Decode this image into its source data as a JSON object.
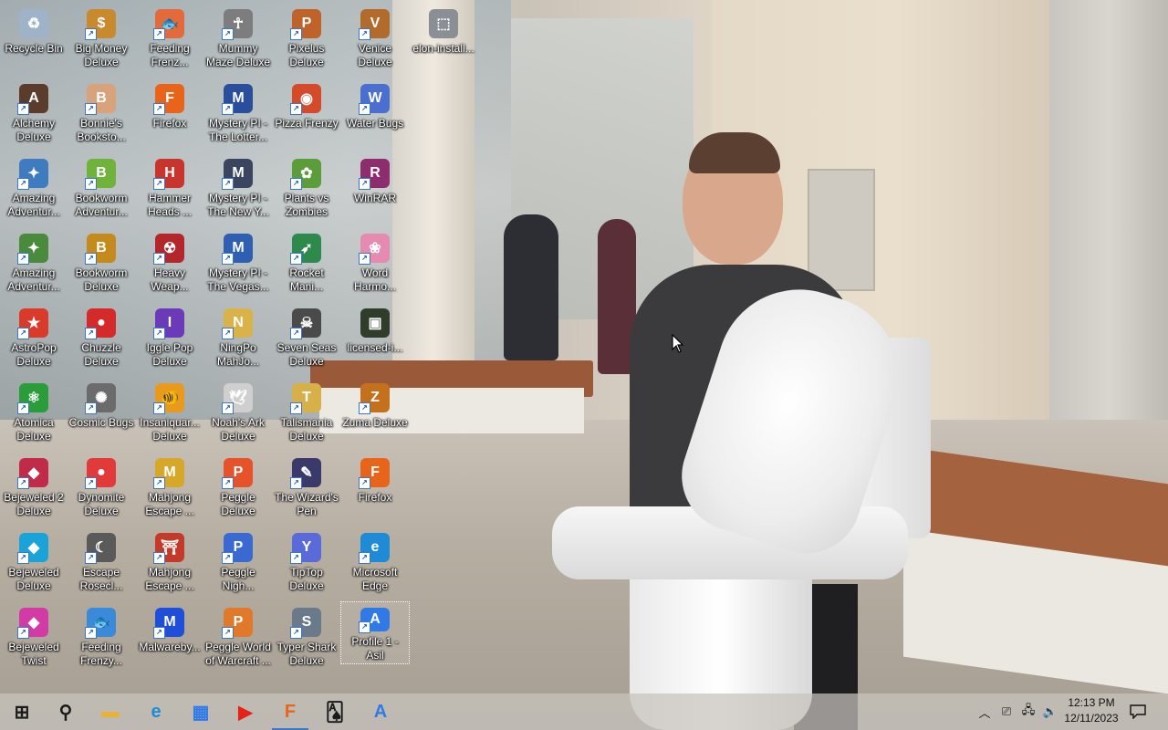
{
  "desktop": {
    "icons": [
      {
        "label": "Recycle Bin",
        "icon": "recycle-bin-icon",
        "color": "#9fb3c8",
        "glyph": "♻"
      },
      {
        "label": "Big Money\nDeluxe",
        "icon": "big-money-icon",
        "color": "#c98a2e",
        "glyph": "$"
      },
      {
        "label": "Feeding\nFrenz...",
        "icon": "feeding-frenzy-icon",
        "color": "#e36a3a",
        "glyph": "🐟"
      },
      {
        "label": "Mummy\nMaze Deluxe",
        "icon": "mummy-maze-icon",
        "color": "#7d7d7d",
        "glyph": "☥"
      },
      {
        "label": "Pixelus\nDeluxe",
        "icon": "pixelus-icon",
        "color": "#c0632b",
        "glyph": "P"
      },
      {
        "label": "Venice\nDeluxe",
        "icon": "venice-icon",
        "color": "#b36b2b",
        "glyph": "V"
      },
      {
        "label": "elon-install...",
        "icon": "installer-file-icon",
        "color": "#8a8f95",
        "glyph": "⬚"
      },
      {
        "label": "Alchemy\nDeluxe",
        "icon": "alchemy-icon",
        "color": "#5b3b2b",
        "glyph": "A"
      },
      {
        "label": "Bonnie's\nBooksto...",
        "icon": "bonnies-bookstore-icon",
        "color": "#d8a27a",
        "glyph": "B"
      },
      {
        "label": "Firefox",
        "icon": "firefox-icon",
        "color": "#e8641b",
        "glyph": "F"
      },
      {
        "label": "Mystery PI -\nThe Lotter...",
        "icon": "mystery-pi-lottery-icon",
        "color": "#2a4e9c",
        "glyph": "M"
      },
      {
        "label": "Pizza Frenzy",
        "icon": "pizza-frenzy-icon",
        "color": "#d34b2a",
        "glyph": "◉"
      },
      {
        "label": "Water Bugs",
        "icon": "water-bugs-icon",
        "color": "#4a6fd1",
        "glyph": "W"
      },
      {
        "label": "Amazing\nAdventur...",
        "icon": "amazing-adventures-icon",
        "color": "#3e7bbf",
        "glyph": "✦"
      },
      {
        "label": "Bookworm\nAdventur...",
        "icon": "bookworm-adventures-icon",
        "color": "#6fb23c",
        "glyph": "B"
      },
      {
        "label": "Hammer\nHeads ...",
        "icon": "hammer-heads-icon",
        "color": "#c7352d",
        "glyph": "H"
      },
      {
        "label": "Mystery PI -\nThe New Y...",
        "icon": "mystery-pi-new-york-icon",
        "color": "#3a4660",
        "glyph": "M"
      },
      {
        "label": "Plants vs\nZombies",
        "icon": "plants-vs-zombies-icon",
        "color": "#5b9d3a",
        "glyph": "✿"
      },
      {
        "label": "WinRAR",
        "icon": "winrar-icon",
        "color": "#8d2d6e",
        "glyph": "R"
      },
      {
        "label": "Amazing\nAdventur...",
        "icon": "amazing-adventures-2-icon",
        "color": "#4a8a3c",
        "glyph": "✦"
      },
      {
        "label": "Bookworm\nDeluxe",
        "icon": "bookworm-deluxe-icon",
        "color": "#c48a1c",
        "glyph": "B"
      },
      {
        "label": "Heavy\nWeap...",
        "icon": "heavy-weapon-icon",
        "color": "#b3262a",
        "glyph": "☢"
      },
      {
        "label": "Mystery PI -\nThe Vegas...",
        "icon": "mystery-pi-vegas-icon",
        "color": "#2f5fb0",
        "glyph": "M"
      },
      {
        "label": "Rocket\nMani...",
        "icon": "rocket-mania-icon",
        "color": "#2e8a4c",
        "glyph": "➶"
      },
      {
        "label": "Word\nHarmo...",
        "icon": "word-harmony-icon",
        "color": "#e58ab0",
        "glyph": "❀"
      },
      {
        "label": "AstroPop\nDeluxe",
        "icon": "astropop-icon",
        "color": "#d93a2a",
        "glyph": "★"
      },
      {
        "label": "Chuzzle\nDeluxe",
        "icon": "chuzzle-icon",
        "color": "#d42a2a",
        "glyph": "●"
      },
      {
        "label": "Iggle Pop\nDeluxe",
        "icon": "iggle-pop-icon",
        "color": "#6a3ab8",
        "glyph": "I"
      },
      {
        "label": "NingPo\nMahJo...",
        "icon": "ningpo-mahjong-icon",
        "color": "#d9b24a",
        "glyph": "N"
      },
      {
        "label": "Seven Seas\nDeluxe",
        "icon": "seven-seas-icon",
        "color": "#4a4a4a",
        "glyph": "☠"
      },
      {
        "label": "licensed-i...",
        "icon": "image-file-icon",
        "color": "#2f3d2a",
        "glyph": "▣"
      },
      {
        "label": "Atomica\nDeluxe",
        "icon": "atomica-icon",
        "color": "#2a9c3a",
        "glyph": "⚛"
      },
      {
        "label": "Cosmic Bugs",
        "icon": "cosmic-bugs-icon",
        "color": "#6b6b6b",
        "glyph": "✺"
      },
      {
        "label": "Insaniquar...\nDeluxe",
        "icon": "insaniquarium-icon",
        "color": "#e89a1c",
        "glyph": "🐠"
      },
      {
        "label": "Noah's Ark\nDeluxe",
        "icon": "noahs-ark-icon",
        "color": "#cfcfcf",
        "glyph": "🕊"
      },
      {
        "label": "Talismania\nDeluxe",
        "icon": "talismania-icon",
        "color": "#d8b04a",
        "glyph": "T"
      },
      {
        "label": "Zuma Deluxe",
        "icon": "zuma-icon",
        "color": "#c4701c",
        "glyph": "Z"
      },
      {
        "label": "Bejeweled 2\nDeluxe",
        "icon": "bejeweled-2-icon",
        "color": "#c22a4a",
        "glyph": "◆"
      },
      {
        "label": "Dynomite\nDeluxe",
        "icon": "dynomite-icon",
        "color": "#e23a3a",
        "glyph": "●"
      },
      {
        "label": "Mahjong\nEscape ...",
        "icon": "mahjong-escape-icon",
        "color": "#d7a72a",
        "glyph": "M"
      },
      {
        "label": "Peggle\nDeluxe",
        "icon": "peggle-deluxe-icon",
        "color": "#e6532a",
        "glyph": "P"
      },
      {
        "label": "The Wizard's\nPen",
        "icon": "wizards-pen-icon",
        "color": "#3a3a6a",
        "glyph": "✎"
      },
      {
        "label": "Firefox",
        "icon": "firefox-2-icon",
        "color": "#e8641b",
        "glyph": "F"
      },
      {
        "label": "Bejeweled\nDeluxe",
        "icon": "bejeweled-icon",
        "color": "#1aa3d9",
        "glyph": "◆"
      },
      {
        "label": "Escape\nRosecl...",
        "icon": "escape-rosecliff-icon",
        "color": "#5a5a5a",
        "glyph": "☾"
      },
      {
        "label": "Mahjong\nEscape ...",
        "icon": "mahjong-escape-2-icon",
        "color": "#c43a2a",
        "glyph": "⛩"
      },
      {
        "label": "Peggle\nNigh...",
        "icon": "peggle-nights-icon",
        "color": "#3a6ad1",
        "glyph": "P"
      },
      {
        "label": "TipTop\nDeluxe",
        "icon": "tiptop-icon",
        "color": "#5a6ad9",
        "glyph": "Y"
      },
      {
        "label": "Microsoft\nEdge",
        "icon": "microsoft-edge-icon",
        "color": "#1f8ad6",
        "glyph": "e"
      },
      {
        "label": "Bejeweled\nTwist",
        "icon": "bejeweled-twist-icon",
        "color": "#d23aa6",
        "glyph": "◆"
      },
      {
        "label": "Feeding\nFrenzy...",
        "icon": "feeding-frenzy-2-icon",
        "color": "#3a8ad9",
        "glyph": "🐟"
      },
      {
        "label": "Malwareby...",
        "icon": "malwarebytes-icon",
        "color": "#1f4fd9",
        "glyph": "M"
      },
      {
        "label": "Peggle World\nof Warcraft ...",
        "icon": "peggle-wow-icon",
        "color": "#e07a2a",
        "glyph": "P"
      },
      {
        "label": "Typer Shark\nDeluxe",
        "icon": "typer-shark-icon",
        "color": "#6a7a8a",
        "glyph": "S"
      },
      {
        "label": "Profile 1 -\nAsil",
        "icon": "browser-profile-icon",
        "color": "#2f7ae6",
        "glyph": "A",
        "selected": true
      }
    ]
  },
  "taskbar": {
    "items": [
      {
        "name": "start-button",
        "icon": "windows-start-icon",
        "color": "#1a1a1a",
        "glyph": "⊞"
      },
      {
        "name": "search-button",
        "icon": "search-icon",
        "color": "#1a1a1a",
        "glyph": "⚲"
      },
      {
        "name": "file-explorer-button",
        "icon": "folder-icon",
        "color": "#e8b23a",
        "glyph": "▬"
      },
      {
        "name": "edge-taskbar-button",
        "icon": "microsoft-edge-icon",
        "color": "#1f8ad6",
        "glyph": "e"
      },
      {
        "name": "store-taskbar-button",
        "icon": "store-icon",
        "color": "#2f7ae6",
        "glyph": "▦"
      },
      {
        "name": "youtube-taskbar-button",
        "icon": "youtube-icon",
        "color": "#e62117",
        "glyph": "▶"
      },
      {
        "name": "firefox-taskbar-button",
        "icon": "firefox-icon",
        "color": "#e8641b",
        "glyph": "F",
        "active": true
      },
      {
        "name": "solitaire-taskbar-button",
        "icon": "cards-icon",
        "color": "#1a1a1a",
        "glyph": "🂡"
      },
      {
        "name": "vpn-taskbar-button",
        "icon": "app-icon",
        "color": "#2f7ae6",
        "glyph": "A"
      }
    ],
    "tray": [
      {
        "name": "show-hidden-icons-button",
        "icon": "chevron-up-icon",
        "glyph": "︿"
      },
      {
        "name": "meet-now-button",
        "icon": "camera-icon",
        "glyph": "⎚"
      },
      {
        "name": "network-button",
        "icon": "network-icon",
        "glyph": "🖧"
      },
      {
        "name": "volume-button",
        "icon": "speaker-muted-icon",
        "glyph": "🔈"
      }
    ],
    "clock": {
      "time": "12:13 PM",
      "date": "12/11/2023"
    },
    "notifications_icon": "notification-icon"
  }
}
